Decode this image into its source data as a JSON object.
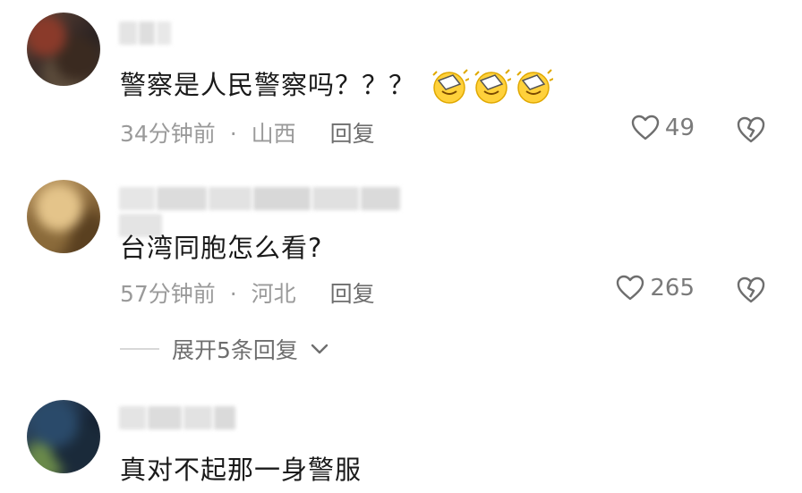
{
  "comments": [
    {
      "text": "警察是人民警察吗？？？",
      "time": "34分钟前",
      "separator": "·",
      "location": "山西",
      "reply_label": "回复",
      "likes": "49",
      "emoji_count": 3,
      "emoji_icon": "salute-emoji-icon"
    },
    {
      "text": "台湾同胞怎么看?",
      "time": "57分钟前",
      "separator": "·",
      "location": "河北",
      "reply_label": "回复",
      "likes": "265",
      "expand_label": "展开5条回复"
    },
    {
      "text": "真对不起那一身警服"
    }
  ],
  "colors": {
    "text": "#1a1a1a",
    "meta": "#9a9a9a",
    "reply": "#6e6e6e",
    "like": "#7a7a7a"
  },
  "icons": {
    "like": "heart-outline-icon",
    "dislike": "broken-heart-icon",
    "expand": "chevron-down-icon"
  }
}
